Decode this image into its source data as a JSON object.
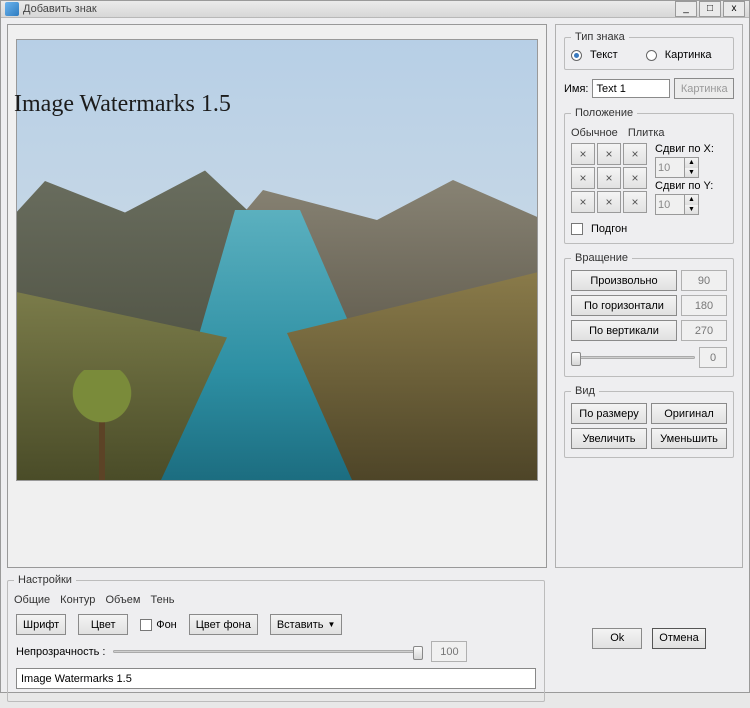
{
  "window": {
    "title": "Добавить знак"
  },
  "watermark_text": "Image Watermarks 1.5",
  "type": {
    "legend": "Тип знака",
    "text_label": "Текст",
    "image_label": "Картинка",
    "selected": "text"
  },
  "name": {
    "label": "Имя:",
    "value": "Text 1",
    "image_button": "Картинка"
  },
  "position": {
    "legend": "Положение",
    "tab_normal": "Обычное",
    "tab_tile": "Плитка",
    "shift_x_label": "Сдвиг по X:",
    "shift_x_value": "10",
    "shift_y_label": "Сдвиг по Y:",
    "shift_y_value": "10",
    "fit_label": "Подгон"
  },
  "rotation": {
    "legend": "Вращение",
    "arbitrary": "Произвольно",
    "horizontal": "По горизонтали",
    "vertical": "По вертикали",
    "val90": "90",
    "val180": "180",
    "val270": "270",
    "slider_value": "0"
  },
  "view": {
    "legend": "Вид",
    "fit": "По размеру",
    "original": "Оригинал",
    "zoom_in": "Увеличить",
    "zoom_out": "Уменьшить"
  },
  "settings": {
    "legend": "Настройки",
    "tabs": {
      "general": "Общие",
      "contour": "Контур",
      "volume": "Объем",
      "shadow": "Тень"
    },
    "font_btn": "Шрифт",
    "color_btn": "Цвет",
    "bg_checkbox": "Фон",
    "bg_color_btn": "Цвет фона",
    "insert_btn": "Вставить",
    "opacity_label": "Непрозрачность :",
    "opacity_value": "100",
    "output_value": "Image Watermarks 1.5"
  },
  "buttons": {
    "ok": "Ok",
    "cancel": "Отмена"
  }
}
